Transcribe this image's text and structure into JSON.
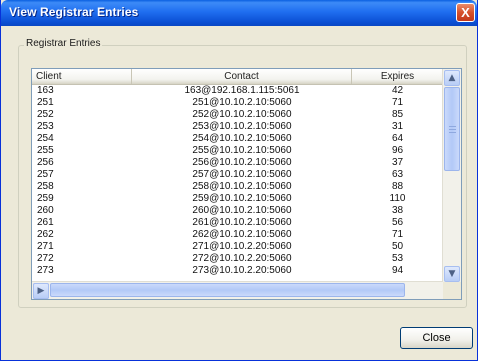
{
  "window": {
    "title": "View Registrar Entries",
    "close_glyph": "X"
  },
  "group": {
    "label": "Registrar Entries"
  },
  "table": {
    "columns": [
      "Client",
      "Contact",
      "Expires"
    ],
    "rows": [
      [
        "163",
        "163@192.168.1.115:5061",
        "42"
      ],
      [
        "251",
        "251@10.10.2.10:5060",
        "71"
      ],
      [
        "252",
        "252@10.10.2.10:5060",
        "85"
      ],
      [
        "253",
        "253@10.10.2.10:5060",
        "31"
      ],
      [
        "254",
        "254@10.10.2.10:5060",
        "64"
      ],
      [
        "255",
        "255@10.10.2.10:5060",
        "96"
      ],
      [
        "256",
        "256@10.10.2.10:5060",
        "37"
      ],
      [
        "257",
        "257@10.10.2.10:5060",
        "63"
      ],
      [
        "258",
        "258@10.10.2.10:5060",
        "88"
      ],
      [
        "259",
        "259@10.10.2.10:5060",
        "110"
      ],
      [
        "260",
        "260@10.10.2.10:5060",
        "38"
      ],
      [
        "261",
        "261@10.10.2.10:5060",
        "56"
      ],
      [
        "262",
        "262@10.10.2.10:5060",
        "71"
      ],
      [
        "271",
        "271@10.10.2.20:5060",
        "50"
      ],
      [
        "272",
        "272@10.10.2.20:5060",
        "53"
      ],
      [
        "273",
        "273@10.10.2.20:5060",
        "94"
      ]
    ]
  },
  "scroll": {
    "up": "▲",
    "down": "▼",
    "left": "◀",
    "right": "▶"
  },
  "buttons": {
    "close_label": "Close"
  }
}
